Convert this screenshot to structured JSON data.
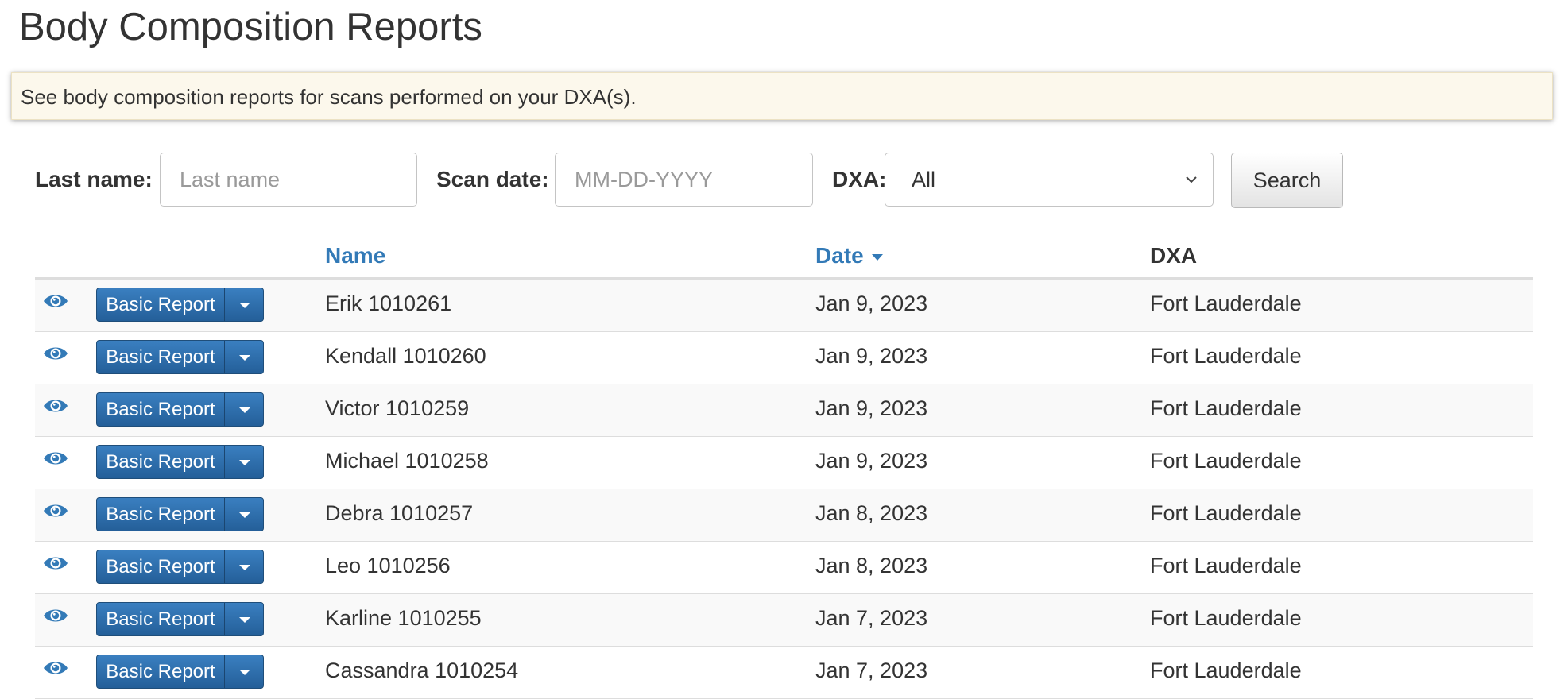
{
  "page_title": "Body Composition Reports",
  "info_banner": "See body composition reports for scans performed on your DXA(s).",
  "search": {
    "last_name_label": "Last name:",
    "last_name_placeholder": "Last name",
    "last_name_value": "",
    "scan_date_label": "Scan date:",
    "scan_date_placeholder": "MM-DD-YYYY",
    "scan_date_value": "",
    "dxa_label": "DXA:",
    "dxa_selected": "All",
    "search_button": "Search"
  },
  "table": {
    "columns": [
      "Name",
      "Date",
      "DXA"
    ],
    "sorted_by": "Date",
    "sort_direction": "descending",
    "report_button": "Basic Report",
    "rows": [
      {
        "name": "Erik 1010261",
        "date": "Jan 9, 2023",
        "dxa": "Fort Lauderdale"
      },
      {
        "name": "Kendall 1010260",
        "date": "Jan 9, 2023",
        "dxa": "Fort Lauderdale"
      },
      {
        "name": "Victor 1010259",
        "date": "Jan 9, 2023",
        "dxa": "Fort Lauderdale"
      },
      {
        "name": "Michael 1010258",
        "date": "Jan 9, 2023",
        "dxa": "Fort Lauderdale"
      },
      {
        "name": "Debra 1010257",
        "date": "Jan 8, 2023",
        "dxa": "Fort Lauderdale"
      },
      {
        "name": "Leo 1010256",
        "date": "Jan 8, 2023",
        "dxa": "Fort Lauderdale"
      },
      {
        "name": "Karline 1010255",
        "date": "Jan 7, 2023",
        "dxa": "Fort Lauderdale"
      },
      {
        "name": "Cassandra 1010254",
        "date": "Jan 7, 2023",
        "dxa": "Fort Lauderdale"
      }
    ]
  },
  "colors": {
    "primary": "#337ab7",
    "button_dark": "#245f99",
    "banner_bg": "#fcf8ec"
  },
  "icons": {
    "view": "eye-icon",
    "dropdown": "caret-down-icon",
    "select": "chevron-down-icon"
  }
}
